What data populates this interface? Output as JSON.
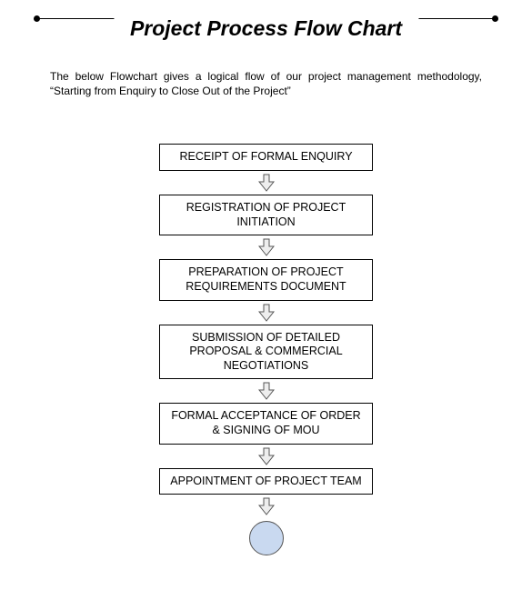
{
  "title": "Project Process Flow Chart",
  "description": "The below Flowchart gives a logical flow of our project management methodology, “Starting from Enquiry to Close Out of the Project”",
  "steps": [
    "RECEIPT OF FORMAL ENQUIRY",
    "REGISTRATION OF PROJECT INITIATION",
    "PREPARATION OF PROJECT REQUIREMENTS DOCUMENT",
    "SUBMISSION OF DETAILED PROPOSAL & COMMERCIAL NEGOTIATIONS",
    "FORMAL ACCEPTANCE OF ORDER & SIGNING OF MOU",
    "APPOINTMENT OF PROJECT TEAM"
  ],
  "colors": {
    "circle_fill": "#c9d9f0",
    "arrow_fill": "#eeeeee"
  }
}
